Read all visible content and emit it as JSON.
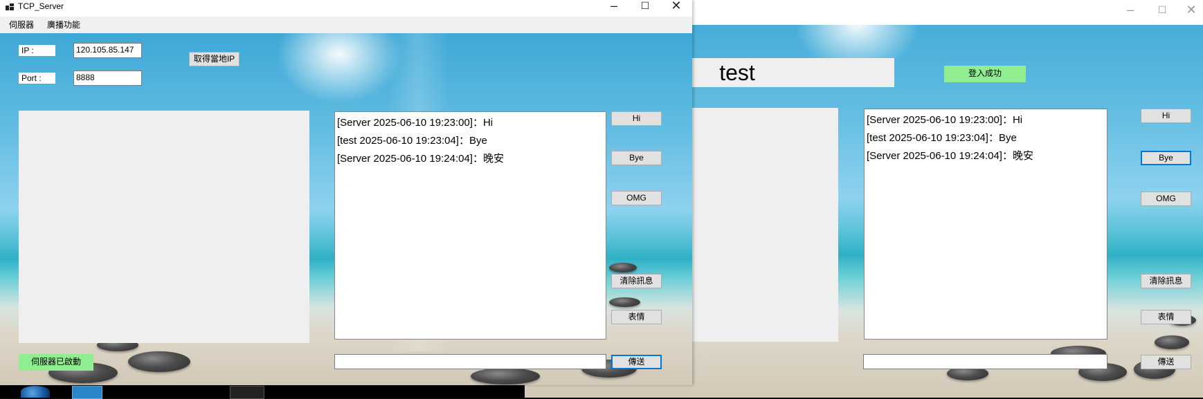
{
  "server": {
    "title": "TCP_Server",
    "menu": [
      "伺服器",
      "廣播功能"
    ],
    "ip_label": "IP :",
    "ip_value": "120.105.85.147",
    "port_label": "Port :",
    "port_value": "8888",
    "get_ip_button": "取得當地IP",
    "messages": [
      "[Server 2025-06-10 19:23:00]：Hi",
      "[test 2025-06-10 19:23:04]：Bye",
      "[Server 2025-06-10 19:24:04]：晚安"
    ],
    "buttons": {
      "hi": "Hi",
      "bye": "Bye",
      "omg": "OMG",
      "clear": "清除訊息",
      "emoji": "表情",
      "send": "傳送"
    },
    "status": "伺服器已啟動"
  },
  "client": {
    "username": "test",
    "login_status": "登入成功",
    "messages": [
      "[Server 2025-06-10 19:23:00]：Hi",
      "[test 2025-06-10 19:23:04]：Bye",
      "[Server 2025-06-10 19:24:04]：晚安"
    ],
    "buttons": {
      "hi": "Hi",
      "bye": "Bye",
      "omg": "OMG",
      "clear": "清除訊息",
      "emoji": "表情",
      "send": "傳送"
    }
  },
  "caption_icons": [
    "minimize-icon",
    "maximize-icon",
    "close-icon"
  ],
  "colors": {
    "status_green": "#90ee90",
    "focus_blue": "#0078d7"
  }
}
